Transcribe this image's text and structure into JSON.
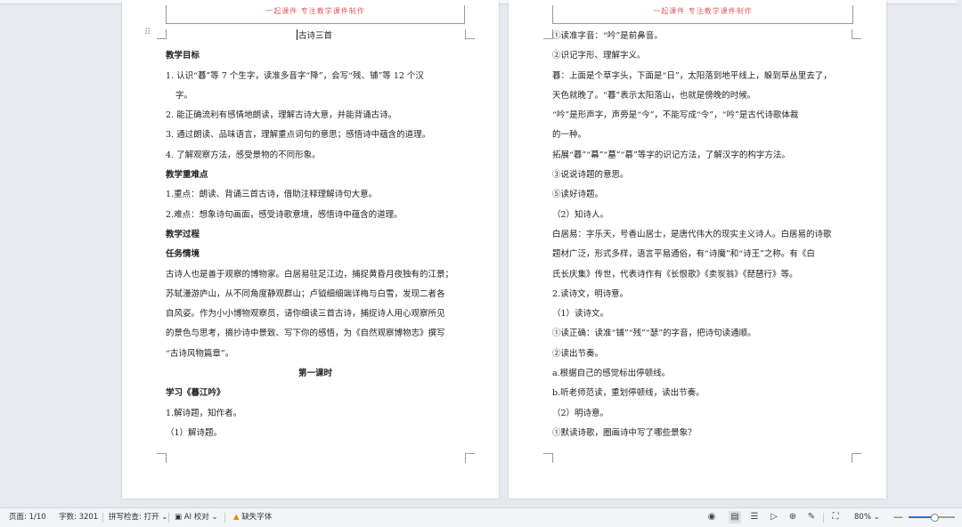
{
  "document": {
    "header_text": "一起课件 专注教学课件制作",
    "left_page": {
      "lines": [
        {
          "text": "古诗三首",
          "style": "title"
        },
        {
          "text": "教学目标",
          "style": "bold"
        },
        {
          "text": "1. 认识“暮”等 7 个生字，读准多音字“降”，会写“残、铺”等 12 个汉",
          "style": "normal"
        },
        {
          "text": "字。",
          "style": "indent"
        },
        {
          "text": "2. 能正确流利有感情地朗读，理解古诗大意，并能背诵古诗。",
          "style": "normal"
        },
        {
          "text": "3. 通过朗读、品味语言，理解重点词句的意思；感悟诗中蕴含的道理。",
          "style": "normal"
        },
        {
          "text": "4. 了解观察方法，感受景物的不同形象。",
          "style": "normal"
        },
        {
          "text": "教学重难点",
          "style": "bold"
        },
        {
          "text": "1.重点：朗读、背诵三首古诗，借助注释理解诗句大意。",
          "style": "normal"
        },
        {
          "text": "2.难点：想象诗句画面，感受诗歌意境，感悟诗中蕴含的道理。",
          "style": "normal"
        },
        {
          "text": "教学过程",
          "style": "bold"
        },
        {
          "text": "任务情境",
          "style": "bold"
        },
        {
          "text": "古诗人也是善于观察的博物家。白居易驻足江边，捕捉黄昏月夜独有的江景；",
          "style": "normal"
        },
        {
          "text": "苏轼漫游庐山，从不同角度静观群山；卢钺细细端详梅与白雪，发现二者各",
          "style": "normal"
        },
        {
          "text": "自风姿。作为小小博物观察员，请你细读三首古诗，捕捉诗人用心观察所见",
          "style": "normal"
        },
        {
          "text": "的景色与思考，摘抄诗中景致、写下你的感悟，为《自然观察博物志》撰写",
          "style": "normal"
        },
        {
          "text": "“古诗风物篇章”。",
          "style": "normal"
        },
        {
          "text": "第一课时",
          "style": "center"
        },
        {
          "text": "学习《暮江吟》",
          "style": "bold"
        },
        {
          "text": "1.解诗题，知作者。",
          "style": "normal"
        },
        {
          "text": "（1）解诗题。",
          "style": "normal"
        }
      ]
    },
    "right_page": {
      "lines": [
        {
          "text": "①读准字音：“吟”是前鼻音。",
          "style": "normal"
        },
        {
          "text": "②识记字形、理解字义。",
          "style": "normal"
        },
        {
          "text": "暮：上面是个草字头，下面是“日”，太阳落到地平线上，躲到草丛里去了，",
          "style": "normal"
        },
        {
          "text": "天色就晚了。“暮”表示太阳落山，也就是傍晚的时候。",
          "style": "normal"
        },
        {
          "text": "“吟”是形声字，声旁是“今”，不能写成“令”，“吟”是古代诗歌体裁",
          "style": "normal"
        },
        {
          "text": "的一种。",
          "style": "normal"
        },
        {
          "text": "拓展“暮”“幕”“墓”“慕”等字的识记方法，了解汉字的构字方法。",
          "style": "normal"
        },
        {
          "text": "③说说诗题的意思。",
          "style": "normal"
        },
        {
          "text": "⑤读好诗题。",
          "style": "normal"
        },
        {
          "text": "（2）知诗人。",
          "style": "normal"
        },
        {
          "text": "白居易：字乐天，号香山居士，是唐代伟大的现实主义诗人。白居易的诗歌",
          "style": "normal"
        },
        {
          "text": "题材广泛，形式多样，语言平易通俗，有“诗魔”和“诗王”之称。有《白",
          "style": "normal"
        },
        {
          "text": "氏长庆集》传世，代表诗作有《长恨歌》《卖炭翁》《琵琶行》等。",
          "style": "normal"
        },
        {
          "text": "2.读诗文，明诗意。",
          "style": "normal"
        },
        {
          "text": "（1）读诗文。",
          "style": "normal"
        },
        {
          "text": "①读正确：读准“铺”“残”“瑟”的字音，把诗句读通顺。",
          "style": "normal"
        },
        {
          "text": "②读出节奏。",
          "style": "normal"
        },
        {
          "text": "a.根据自己的感觉标出停顿线。",
          "style": "normal"
        },
        {
          "text": "b.听老师范读，重划停顿线，读出节奏。",
          "style": "normal"
        },
        {
          "text": "（2）明诗意。",
          "style": "normal"
        },
        {
          "text": "①默读诗歌，圈画诗中写了哪些景象？",
          "style": "normal"
        }
      ]
    }
  },
  "statusbar": {
    "page": "页面: 1/10",
    "word_count": "字数: 3201",
    "spell_check": "拼写检查: 打开",
    "ai_check": "AI 校对",
    "missing_fonts": "缺失字体",
    "zoom": "80%",
    "zoom_level": 0.55,
    "icons": [
      "eye-icon",
      "page-view-icon",
      "outline-view-icon",
      "play-icon",
      "web-view-icon",
      "pen-icon",
      "fullscreen-icon"
    ]
  }
}
